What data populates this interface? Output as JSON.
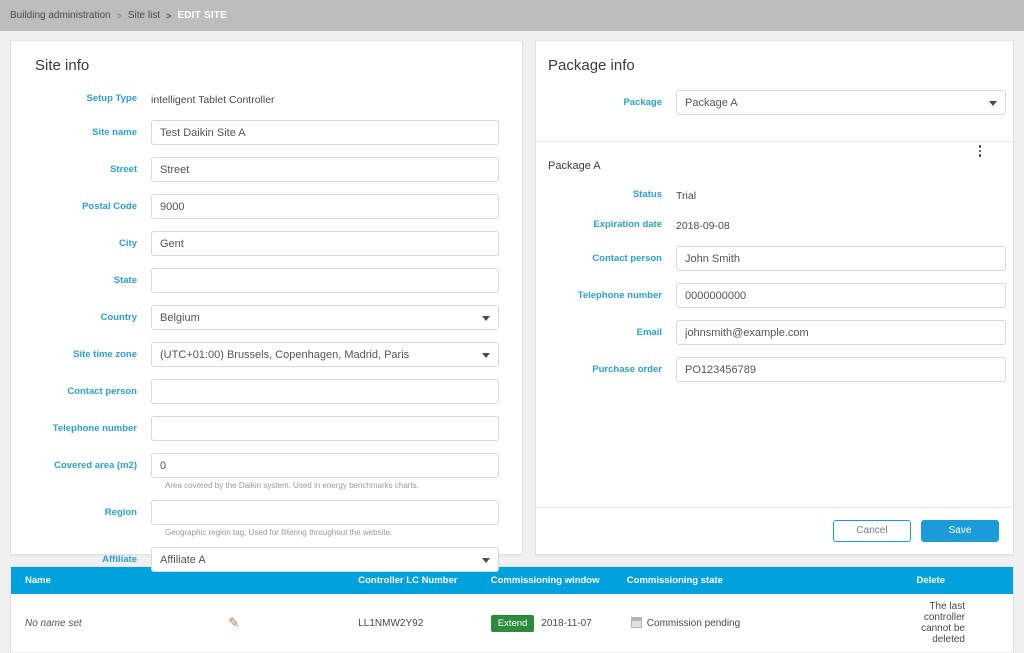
{
  "breadcrumb": {
    "root": "Building administration",
    "sep1": ">",
    "level2": "Site list",
    "sep2": ">",
    "current": "EDIT SITE"
  },
  "colors": {
    "accent_blue": "#1b9bd8",
    "label_blue": "#2e9fd4",
    "table_header": "#00a2dd",
    "extend_green": "#2e8b3d",
    "topbar_grey": "#bdbdbb"
  },
  "site_info": {
    "title": "Site info",
    "setup_type": {
      "label": "Setup Type",
      "value": "intelligent Tablet Controller"
    },
    "site_name": {
      "label": "Site name",
      "value": "Test Daikin Site A"
    },
    "street": {
      "label": "Street",
      "value": "Street"
    },
    "postal_code": {
      "label": "Postal Code",
      "value": "9000"
    },
    "city": {
      "label": "City",
      "value": "Gent"
    },
    "state": {
      "label": "State",
      "value": ""
    },
    "country": {
      "label": "Country",
      "value": "Belgium"
    },
    "time_zone": {
      "label": "Site time zone",
      "value": "(UTC+01:00) Brussels, Copenhagen, Madrid, Paris"
    },
    "contact_person": {
      "label": "Contact person",
      "value": ""
    },
    "telephone_number": {
      "label": "Telephone number",
      "value": ""
    },
    "covered_area": {
      "label": "Covered area (m2)",
      "value": "0",
      "help": "Area covered by the Daikin system. Used in energy benchmarks charts."
    },
    "region": {
      "label": "Region",
      "value": "",
      "help": "Geographic region tag. Used for filtering throughout the website."
    },
    "affiliate": {
      "label": "Affiliate",
      "value": "Affiliate A"
    }
  },
  "package_info": {
    "title": "Package info",
    "package": {
      "label": "Package",
      "value": "Package A"
    },
    "subtitle": "Package A",
    "menu_icon": "kebab-menu-icon",
    "status": {
      "label": "Status",
      "value": "Trial"
    },
    "expiration_date": {
      "label": "Expiration date",
      "value": "2018-09-08"
    },
    "contact_person": {
      "label": "Contact person",
      "value": "John Smith"
    },
    "telephone_number": {
      "label": "Telephone number",
      "value": "0000000000"
    },
    "email": {
      "label": "Email",
      "value": "johnsmith@example.com"
    },
    "purchase_order": {
      "label": "Purchase order",
      "value": "PO123456789"
    },
    "cancel_label": "Cancel",
    "save_label": "Save"
  },
  "controllers_table": {
    "headers": {
      "name": "Name",
      "lc_number": "Controller LC Number",
      "commissioning_window": "Commissioning window",
      "commissioning_state": "Commissioning state",
      "delete": "Delete"
    },
    "rows": [
      {
        "name": "No name set",
        "edit_icon": "pencil-icon",
        "lc_number": "LL1NMW2Y92",
        "extend_label": "Extend",
        "window_date": "2018-11-07",
        "state_icon": "calendar-icon",
        "state": "Commission pending",
        "delete_text": "The last controller cannot be deleted"
      }
    ]
  }
}
